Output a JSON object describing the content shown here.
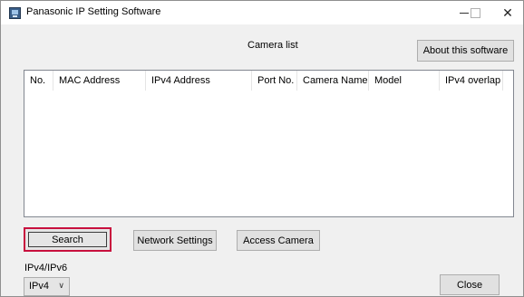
{
  "window": {
    "title": "Panasonic IP Setting Software",
    "minimize_glyph": "–",
    "maximize_glyph": "□",
    "close_glyph": "✕"
  },
  "header": {
    "camera_list_label": "Camera list",
    "about_button": "About this software"
  },
  "table": {
    "columns": [
      "No.",
      "MAC Address",
      "IPv4 Address",
      "Port No.",
      "Camera Name",
      "Model",
      "IPv4 overlap"
    ],
    "rows": []
  },
  "actions": {
    "search_button": "Search",
    "network_settings_button": "Network Settings",
    "access_camera_button": "Access Camera",
    "close_button": "Close"
  },
  "ip_mode": {
    "label": "IPv4/IPv6",
    "selected": "IPv4",
    "arrow": "∨"
  },
  "colors": {
    "focus_highlight": "#c8103e",
    "window_background": "#f0f0f0"
  }
}
